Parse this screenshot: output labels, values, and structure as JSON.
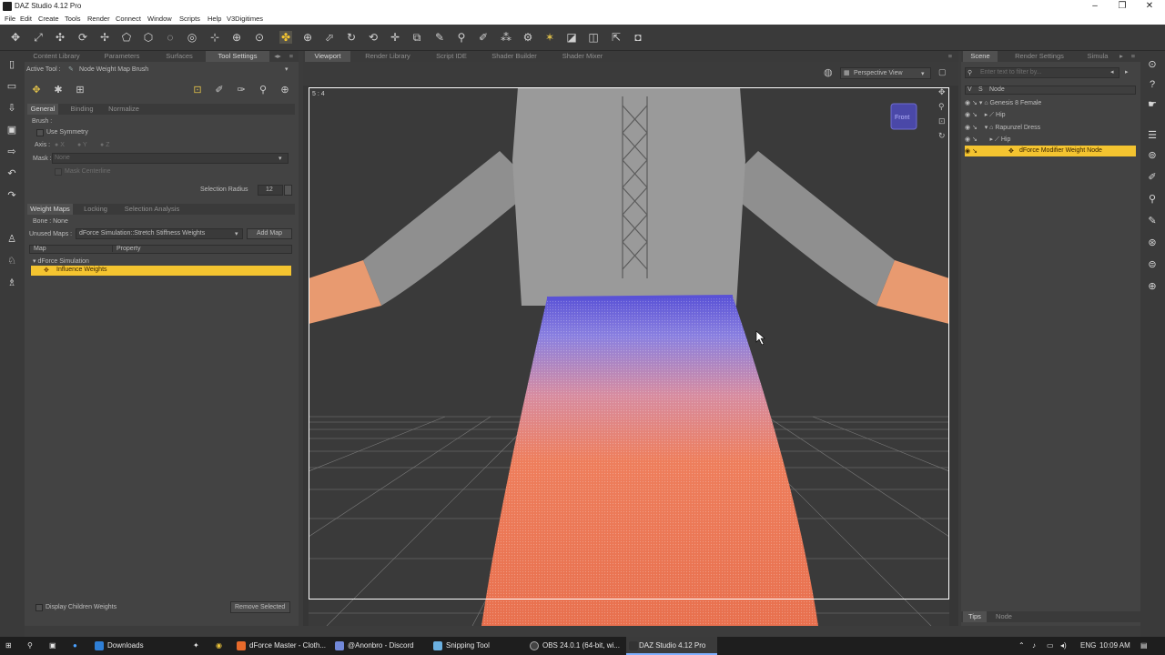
{
  "window": {
    "title": "DAZ Studio 4.12 Pro"
  },
  "menu": [
    "File",
    "Edit",
    "Create",
    "Tools",
    "Render",
    "Connect",
    "Window",
    "Scripts",
    "Help",
    "V3Digitimes"
  ],
  "left_tabs": [
    "Content Library",
    "Parameters",
    "Surfaces",
    "Tool Settings"
  ],
  "active_tool": {
    "label": "Active Tool :",
    "value": "Node Weight Map Brush"
  },
  "brush_tabs": [
    "General",
    "Binding",
    "Normalize"
  ],
  "brush": {
    "section": "Brush :",
    "use_symmetry": "Use Symmetry",
    "axis_label": "Axis :",
    "axis_options": [
      "X",
      "Y",
      "Z"
    ],
    "mask_label": "Mask :",
    "mask_value": "None",
    "mask_centerline": "Mask Centerline",
    "selection_radius_label": "Selection Radius",
    "selection_radius_value": "12"
  },
  "weight_tabs": [
    "Weight Maps",
    "Locking",
    "Selection Analysis"
  ],
  "weight_maps": {
    "bone": "Bone : None",
    "unused_label": "Unused Maps :",
    "unused_value": "dForce Simulation::Stretch Stiffness Weights",
    "add_map": "Add Map",
    "col_map": "Map",
    "col_property": "Property",
    "group": "dForce Simulation",
    "selected": "Influence Weights",
    "display_children": "Display Children Weights",
    "remove_selected": "Remove Selected"
  },
  "viewport_tabs": [
    "Viewport",
    "Render Library",
    "Script IDE",
    "Shader Builder",
    "Shader Mixer"
  ],
  "viewport": {
    "aspect": "5 : 4",
    "view_mode": "Perspective View",
    "cube_label": "Front"
  },
  "right_tabs": [
    "Scene",
    "Render Settings",
    "Simula"
  ],
  "scene": {
    "filter_placeholder": "Enter text to filter by...",
    "col_v": "V",
    "col_s": "S",
    "col_node": "Node",
    "nodes": [
      "Genesis 8 Female",
      "Hip",
      "Rapunzel Dress",
      "Hip",
      "dForce Modifier Weight Node"
    ],
    "bottom_tabs": [
      "Tips",
      "Node"
    ]
  },
  "taskbar": {
    "items": [
      "Downloads",
      "dForce Master - Cloth...",
      "@Anonbro - Discord",
      "Snipping Tool",
      "OBS 24.0.1 (64-bit, wi...",
      "DAZ Studio 4.12 Pro"
    ],
    "lang": "ENG",
    "time": "10:09 AM"
  },
  "colors": {
    "accent": "#f4c430",
    "skirt": "#e8704e",
    "bodice": "#9a9a9a",
    "weight_blue": "#5a52d6"
  }
}
